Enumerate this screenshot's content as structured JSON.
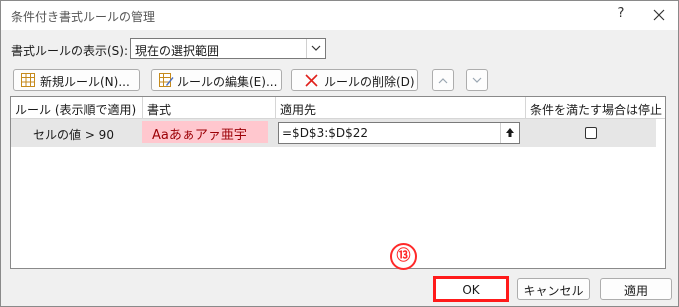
{
  "window": {
    "title": "条件付き書式ルールの管理",
    "help": "?"
  },
  "show_rules": {
    "label": "書式ルールの表示(S):",
    "value": "現在の選択範囲"
  },
  "toolbar": {
    "new_rule": "新規ルール(N)...",
    "edit_rule": "ルールの編集(E)...",
    "delete_rule": "ルールの削除(D)"
  },
  "table": {
    "columns": [
      "ルール (表示順で適用)",
      "書式",
      "適用先",
      "条件を満たす場合は停止"
    ],
    "rows": [
      {
        "rule": "セルの値 > 90",
        "format_preview": "Aaあぁアァ亜宇",
        "applies_to": "=$D$3:$D$22",
        "stop_if_true": false
      }
    ]
  },
  "annotation": {
    "step": "⑬"
  },
  "footer": {
    "ok": "OK",
    "cancel": "キャンセル",
    "apply": "適用"
  },
  "colors": {
    "format_fill": "#ffc7ce",
    "format_text": "#9c0006",
    "highlight": "#ff1a1a"
  }
}
